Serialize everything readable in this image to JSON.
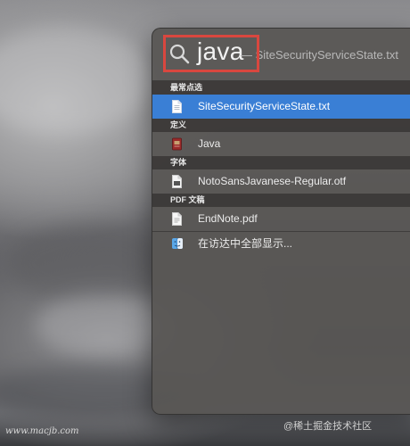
{
  "search": {
    "query": "java",
    "completion": "— SiteSecurityServiceState.txt"
  },
  "sections": [
    {
      "header": "最常点选",
      "items": [
        {
          "label": "SiteSecurityServiceState.txt",
          "icon": "text-file-icon",
          "selected": true
        }
      ]
    },
    {
      "header": "定义",
      "items": [
        {
          "label": "Java",
          "icon": "dictionary-icon",
          "selected": false
        }
      ]
    },
    {
      "header": "字体",
      "items": [
        {
          "label": "NotoSansJavanese-Regular.otf",
          "icon": "font-file-icon",
          "selected": false
        }
      ]
    },
    {
      "header": "PDF 文稿",
      "items": [
        {
          "label": "EndNote.pdf",
          "icon": "pdf-file-icon",
          "selected": false
        }
      ]
    }
  ],
  "show_all_in_finder": "在访达中全部显示...",
  "watermarks": {
    "left": "www.macjb.com",
    "right": "@稀土掘金技术社区"
  },
  "colors": {
    "selection": "#3a7fd5",
    "highlight_box": "#d9473f"
  }
}
